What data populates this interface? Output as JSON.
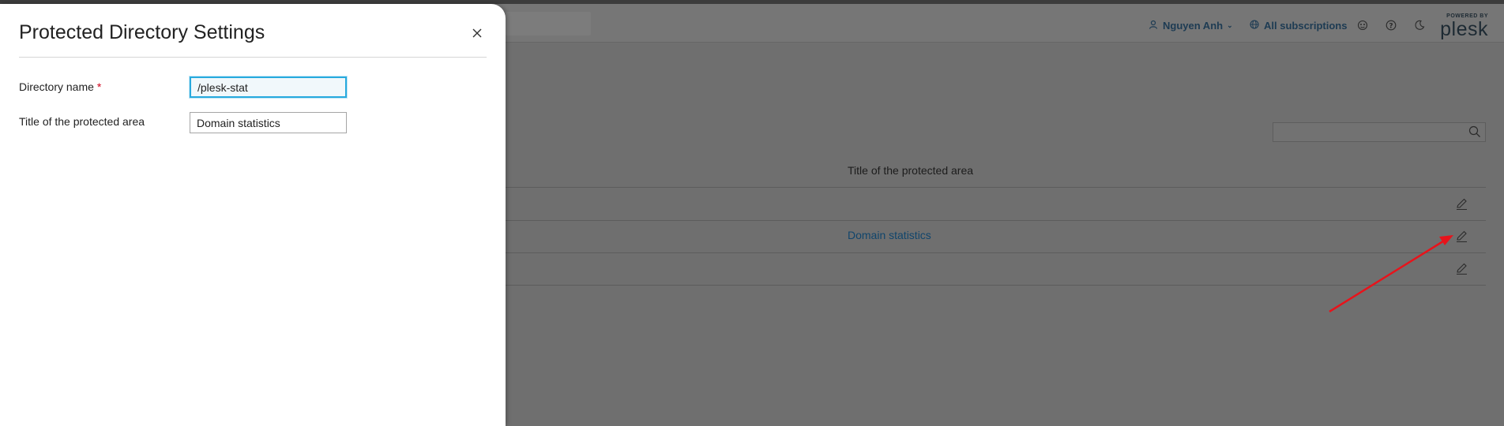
{
  "header": {
    "user_name": "Nguyen Anh",
    "subscriptions_label": "All subscriptions",
    "logo_powered": "POWERED BY",
    "logo_brand": "plesk"
  },
  "background": {
    "column_header": "Title of the protected area",
    "rows": [
      {
        "title": ""
      },
      {
        "title": "Domain statistics"
      },
      {
        "title": ""
      }
    ]
  },
  "dialog": {
    "title": "Protected Directory Settings",
    "fields": {
      "directory_name": {
        "label": "Directory name",
        "required_mark": "*",
        "value": "/plesk-stat"
      },
      "protected_area_title": {
        "label": "Title of the protected area",
        "value": "Domain statistics"
      }
    }
  },
  "colors": {
    "accent": "#28aade",
    "link": "#10456c",
    "required": "#d0021b",
    "annotation_arrow": "#e8131b"
  }
}
